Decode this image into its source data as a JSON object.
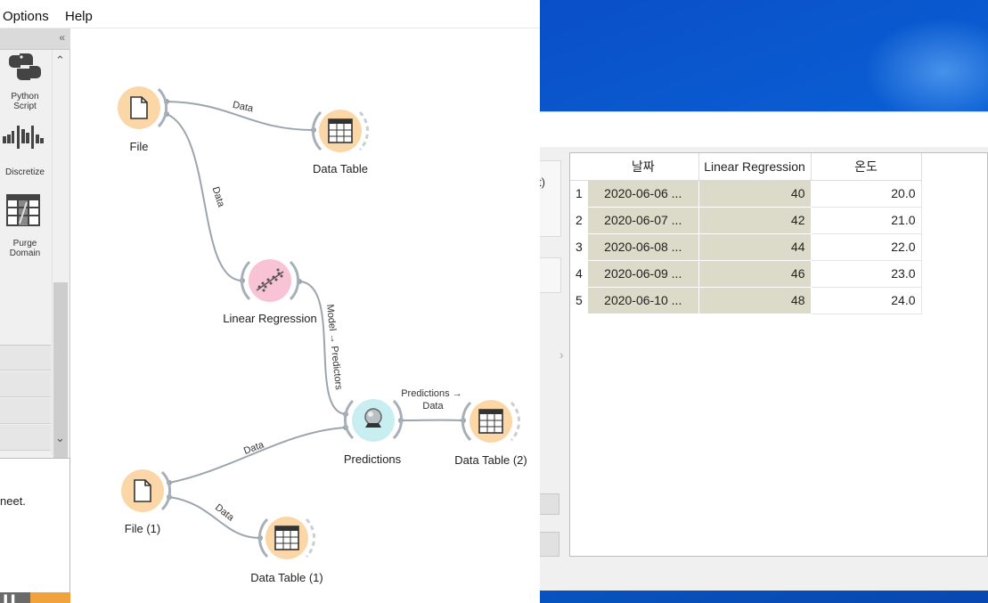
{
  "menubar": {
    "items": [
      "Options",
      "Help"
    ]
  },
  "toolbox": {
    "collapse_glyph": "«",
    "widgets": [
      {
        "label": "Python\nScript",
        "icon": "python-icon"
      },
      {
        "label": "Discretize",
        "icon": "discretize-icon"
      },
      {
        "label": "Purge\nDomain",
        "icon": "purge-domain-icon"
      }
    ],
    "scroll_up": "⌃",
    "scroll_down": "⌄"
  },
  "info_pane": {
    "text": "neet."
  },
  "canvas": {
    "nodes": [
      {
        "id": "file",
        "label": "File",
        "icon": "file-icon",
        "color": "#fbd7a8"
      },
      {
        "id": "data-table",
        "label": "Data Table",
        "icon": "table-icon",
        "color": "#fbd7a8"
      },
      {
        "id": "linear-regression",
        "label": "Linear Regression",
        "icon": "regression-icon",
        "color": "#f8c3d4"
      },
      {
        "id": "predictions",
        "label": "Predictions",
        "icon": "crystal-ball-icon",
        "color": "#c9eef2"
      },
      {
        "id": "data-table-2",
        "label": "Data Table (2)",
        "icon": "table-icon",
        "color": "#fbd7a8"
      },
      {
        "id": "file-1",
        "label": "File (1)",
        "icon": "file-icon",
        "color": "#fbd7a8"
      },
      {
        "id": "data-table-1",
        "label": "Data Table (1)",
        "icon": "table-icon",
        "color": "#fbd7a8"
      }
    ],
    "links": [
      {
        "from": "file",
        "to": "data-table",
        "label": "Data"
      },
      {
        "from": "file",
        "to": "linear-regression",
        "label": "Data"
      },
      {
        "from": "linear-regression",
        "to": "predictions",
        "label": "Model → Predictors"
      },
      {
        "from": "predictions",
        "to": "data-table-2",
        "label": "Predictions →\nData"
      },
      {
        "from": "file-1",
        "to": "predictions",
        "label": "Data"
      },
      {
        "from": "file-1",
        "to": "data-table-1",
        "label": "Data"
      }
    ]
  },
  "data_table_window": {
    "left_panel_text": "t)",
    "scroll_hint": "›",
    "columns": [
      "날짜",
      "Linear Regression",
      "온도"
    ],
    "rows": [
      {
        "n": "1",
        "date": "2020-06-06 ...",
        "lr": "40",
        "temp": "20.0"
      },
      {
        "n": "2",
        "date": "2020-06-07 ...",
        "lr": "42",
        "temp": "21.0"
      },
      {
        "n": "3",
        "date": "2020-06-08 ...",
        "lr": "44",
        "temp": "22.0"
      },
      {
        "n": "4",
        "date": "2020-06-09 ...",
        "lr": "46",
        "temp": "23.0"
      },
      {
        "n": "5",
        "date": "2020-06-10 ...",
        "lr": "48",
        "temp": "24.0"
      }
    ]
  },
  "colors": {
    "desktop": "#0a5fd6",
    "meta_cell": "#dcdbc9",
    "link": "#9aa5ae",
    "orange_status": "#f0a23c"
  }
}
